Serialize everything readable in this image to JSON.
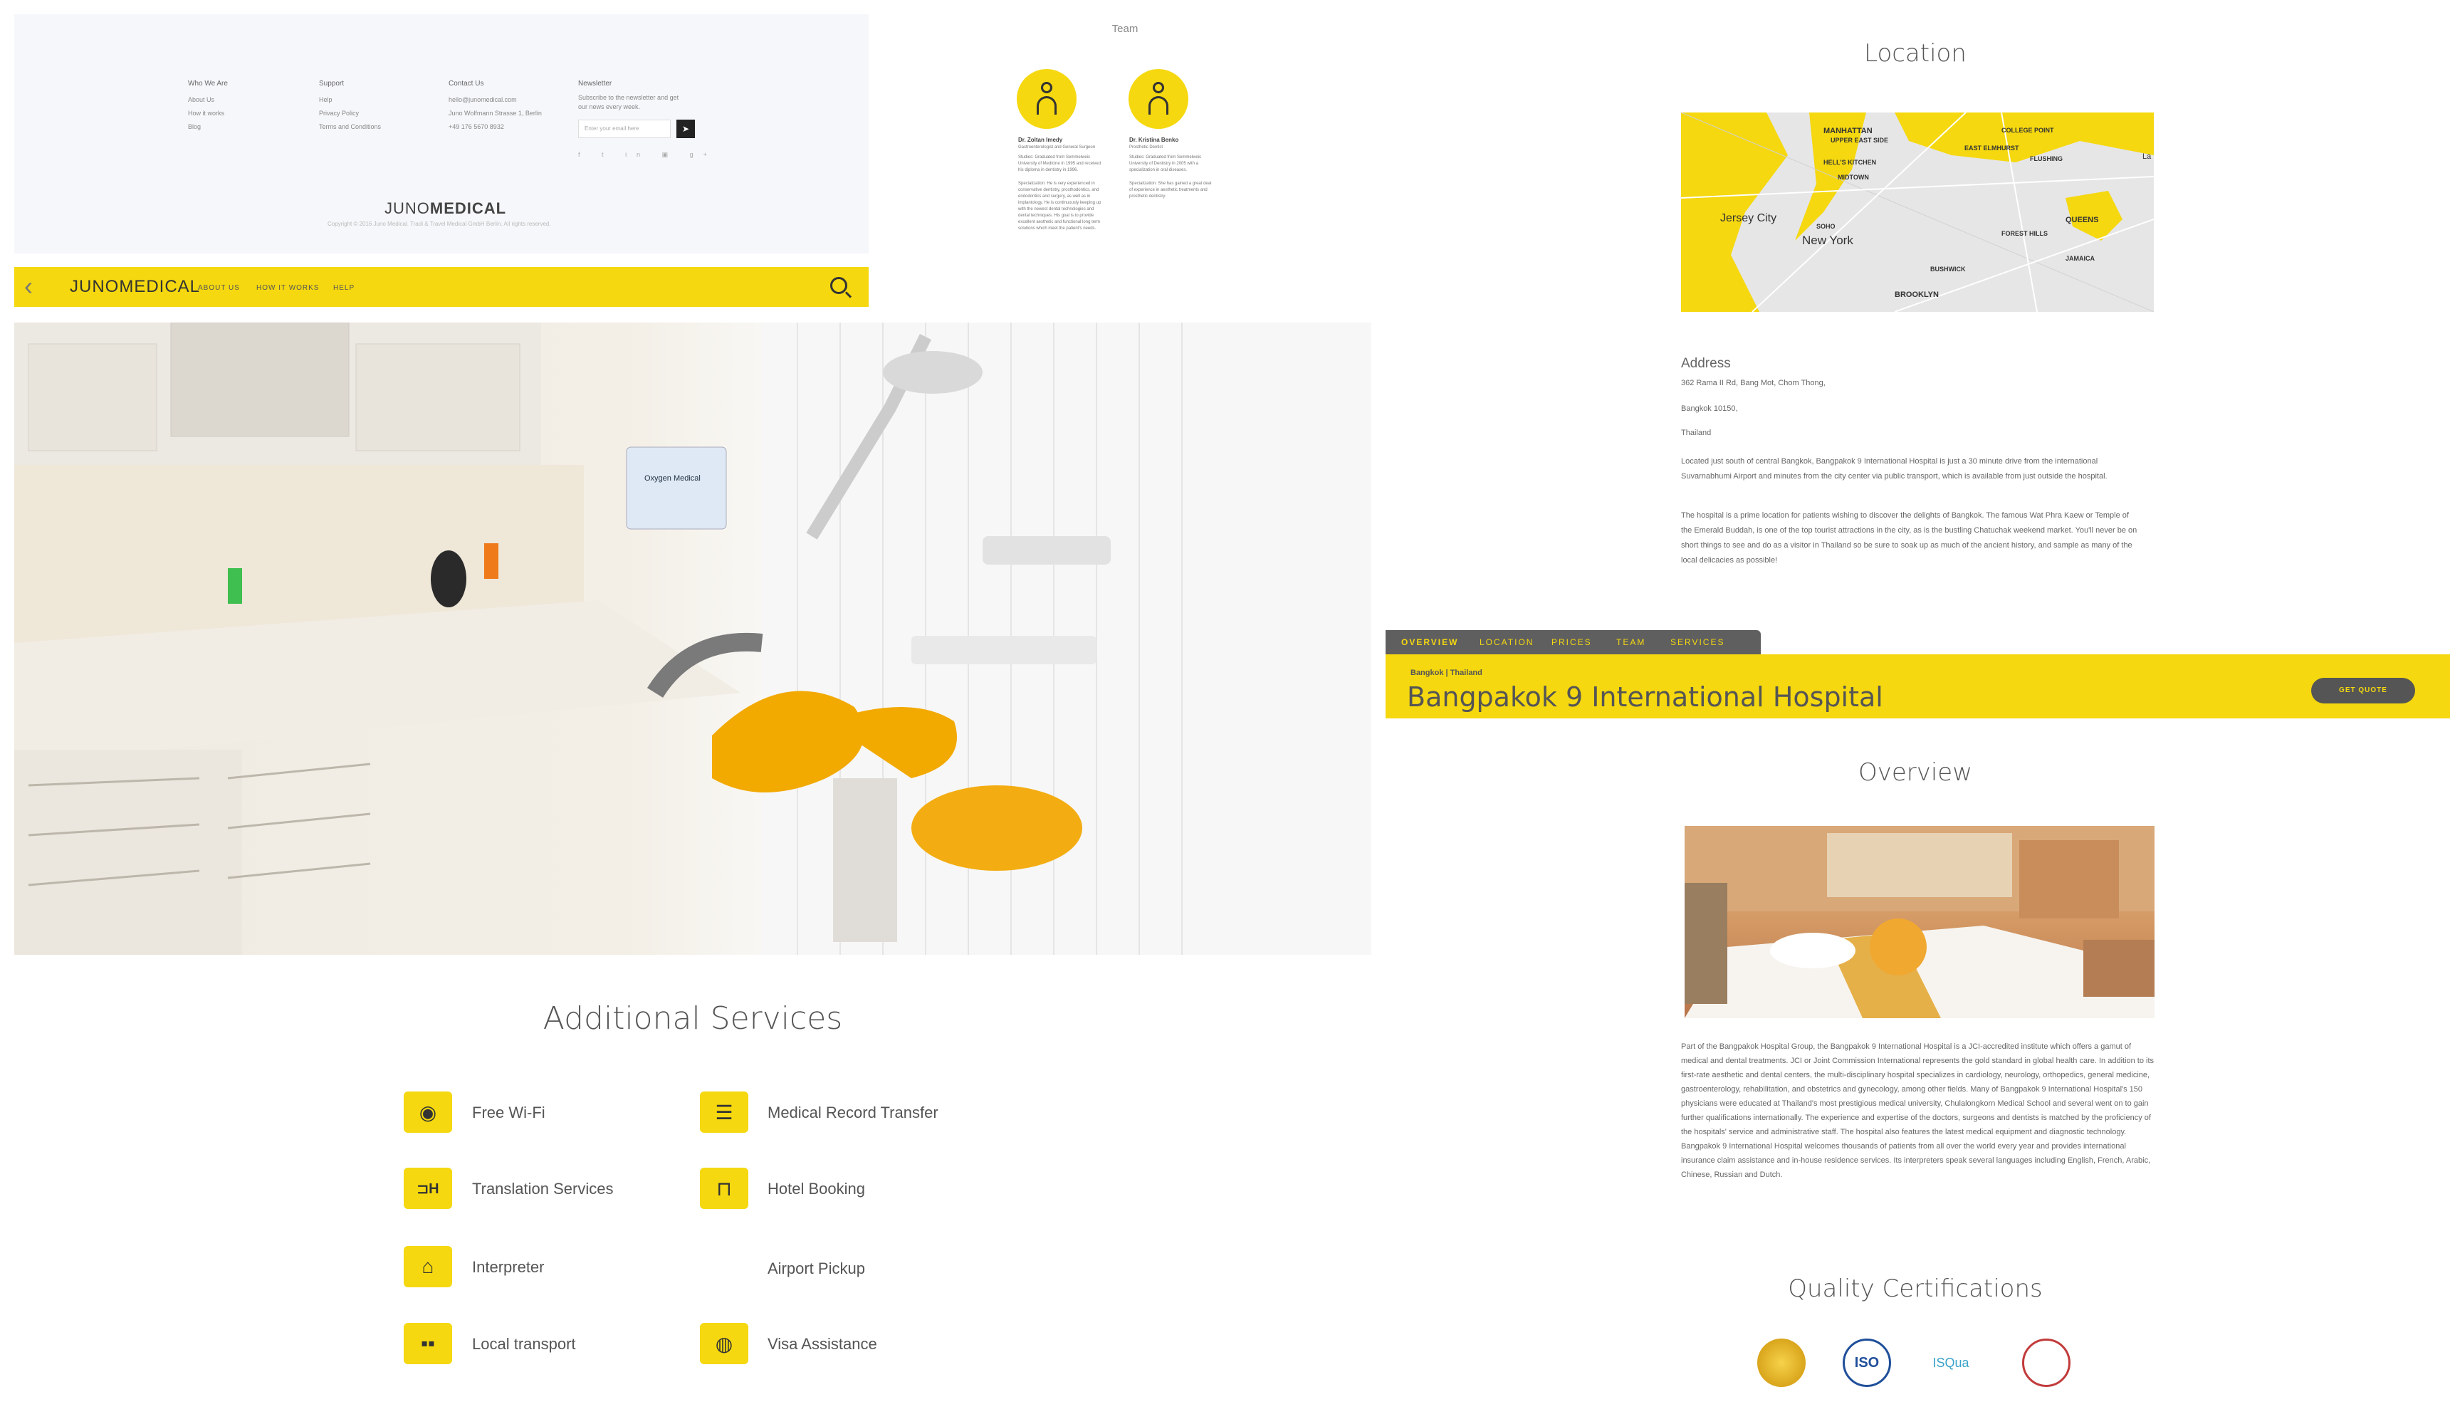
{
  "footer": {
    "columns": [
      {
        "heading": "Who We Are",
        "items": [
          "About Us",
          "How it works",
          "Blog"
        ]
      },
      {
        "heading": "Support",
        "items": [
          "Help",
          "Privacy Policy",
          "Terms and Conditions"
        ]
      },
      {
        "heading": "Contact Us",
        "items": [
          "hello@junomedical.com",
          "Juno Wolfmann Strasse 1, Berlin",
          "+49 176 5670 8932"
        ]
      }
    ],
    "newsletter": {
      "heading": "Newsletter",
      "text": "Subscribe to the newsletter and get our news every week.",
      "placeholder": "Enter your email here",
      "submit_icon": "send-arrow-icon"
    },
    "socials": [
      "f",
      "t",
      "in",
      "▣",
      "g+"
    ],
    "logo_light": "JUNO",
    "logo_bold": "MEDICAL",
    "copyright": "Copyright © 2016 Juno Medical. Tradi & Travel Medical GmbH Berlin. All rights reserved."
  },
  "navbar": {
    "logo_light": "JUNO",
    "logo_bold": "MEDICAL",
    "links": [
      "ABOUT US",
      "HOW IT WORKS",
      "HELP"
    ],
    "back_icon": "chevron-left-icon",
    "search_icon": "search-icon",
    "accent": "#f5d80f"
  },
  "dental_photo": {
    "screen_text": "Oxygen Medical"
  },
  "services": {
    "title": "Additional Services",
    "left": [
      {
        "label": "Free Wi-Fi",
        "icon": "wifi-icon"
      },
      {
        "label": "Translation Services",
        "icon": "translation-icon"
      },
      {
        "label": "Interpreter",
        "icon": "interpreter-icon"
      },
      {
        "label": "Local transport",
        "icon": "bus-icon"
      }
    ],
    "right": [
      {
        "label": "Medical Record Transfer",
        "icon": "document-transfer-icon"
      },
      {
        "label": "Hotel Booking",
        "icon": "bed-icon"
      },
      {
        "label": "Airport Pickup",
        "icon": ""
      },
      {
        "label": "Visa Assistance",
        "icon": "globe-icon"
      }
    ]
  },
  "team": {
    "title": "Team",
    "members": [
      {
        "name": "Dr. Zoltan Imedy",
        "role": "Gastroenterologist and General Surgeon",
        "studies": "Studies: Graduated from Semmelweis University of Medicine in 1995 and received his diploma in dentistry in 1996.",
        "specialization": "Specialization: He is very experienced in conservative dentistry, prosthodontics, and endodontics and surgery, as well as in implantology. He is continuously keeping up with the newest dental technologies and dental techniques. His goal is to provide excellent aesthetic and functional long term solutions which meet the patient's needs."
      },
      {
        "name": "Dr. Kristina Benko",
        "role": "Prosthetic Dentist",
        "studies": "Studies: Graduated from Semmelweis University of Dentistry in 2005 with a specialization in oral diseases.",
        "specialization": "Specialization: She has gained a great deal of experience in aesthetic treatments and prosthetic dentistry."
      }
    ]
  },
  "location": {
    "title": "Location",
    "map_labels": [
      "MANHATTAN",
      "UPPER EAST SIDE",
      "HELL'S KITCHEN",
      "MIDTOWN",
      "Jersey City",
      "SOHO",
      "New York",
      "EAST ELMHURST",
      "FLUSHING",
      "COLLEGE POINT",
      "QUEENS",
      "FOREST HILLS",
      "JAMAICA",
      "BUSHWICK",
      "BROOKLYN",
      "La"
    ],
    "address_heading": "Address",
    "address_lines": [
      "362 Rama II Rd, Bang Mot, Chom Thong,",
      "Bangkok 10150,",
      "Thailand"
    ],
    "para1": "Located just south of central Bangkok, Bangpakok 9 International Hospital is just a 30 minute drive from the international Suvarnabhumi Airport and minutes from the city center via public transport, which is available from just outside the hospital.",
    "para2": "The hospital is a prime location for patients wishing to discover the delights of Bangkok. The famous Wat Phra Kaew or Temple of the Emerald Buddah, is one of the top tourist attractions in the city, as is the bustling Chatuchak weekend market. You'll never be on short things to see and do as a visitor in Thailand so be sure to soak up as much of the ancient history, and sample as many of the local delicacies as possible!"
  },
  "tabs": [
    "OVERVIEW",
    "LOCATION",
    "PRICES",
    "TEAM",
    "SERVICES"
  ],
  "hospital": {
    "location": "Bangkok | Thailand",
    "name": "Bangpakok 9 International Hospital",
    "cta": "GET QUOTE"
  },
  "overview": {
    "title": "Overview",
    "text": "Part of the Bangpakok Hospital Group, the Bangpakok 9 International Hospital is a JCI-accredited institute which offers a gamut of medical and dental treatments. JCI or Joint Commission International represents the gold standard in global health care. In addition to its first-rate aesthetic and dental centers, the multi-disciplinary hospital specializes in cardiology, neurology, orthopedics, general medicine, gastroenterology, rehabilitation, and obstetrics and gynecology, among other fields. Many of Bangpakok 9 International Hospital's 150 physicians were educated at Thailand's most prestigious medical university, Chulalongkorn Medical School and several went on to gain further qualifications internationally. The experience and expertise of the doctors, surgeons and dentists is matched by the proficiency of the hospitals' service and administrative staff. The hospital also features the latest medical equipment and diagnostic technology. Bangpakok 9 International Hospital welcomes thousands of patients from all over the world every year and provides international insurance claim assistance and in-house residence services. Its interpreters speak several languages including English, French, Arabic, Chinese, Russian and Dutch."
  },
  "quality": {
    "title": "Quality Certifications",
    "certs": [
      {
        "name": "gold-seal-icon",
        "color": "#d9a51c"
      },
      {
        "name": "iso-icon",
        "color": "#1f4f9a",
        "text": "ISO"
      },
      {
        "name": "isqua-icon",
        "color": "#3aa3c9",
        "text": "ISQua"
      },
      {
        "name": "accreditation-seal-icon",
        "color": "#c23b3b"
      }
    ]
  }
}
